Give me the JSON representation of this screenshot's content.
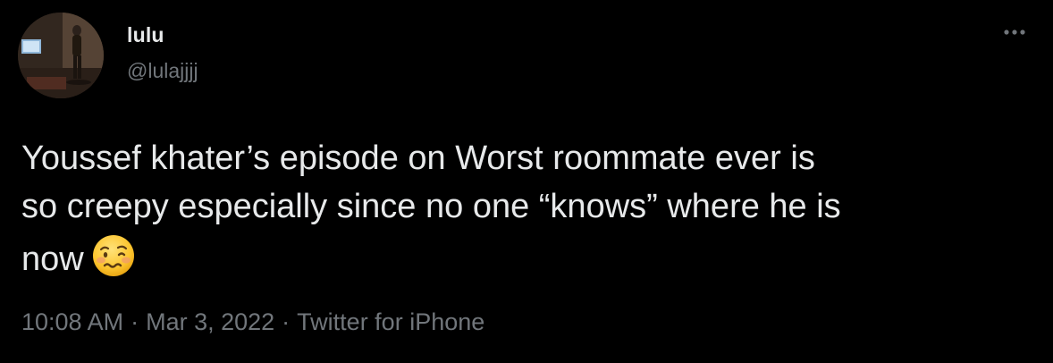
{
  "tweet": {
    "author": {
      "display_name": "lulu",
      "handle": "@lulajjjj"
    },
    "text": "Youssef khater’s episode on Worst roommate ever is\nso creepy especially since no one “knows” where he is\nnow",
    "emoji": "woozy-face",
    "time": "10:08 AM",
    "date": "Mar 3, 2022",
    "source": "Twitter for iPhone",
    "separator": "·"
  },
  "colors": {
    "background": "#000000",
    "primary_text": "#e7e9ea",
    "secondary_text": "#71767b"
  }
}
